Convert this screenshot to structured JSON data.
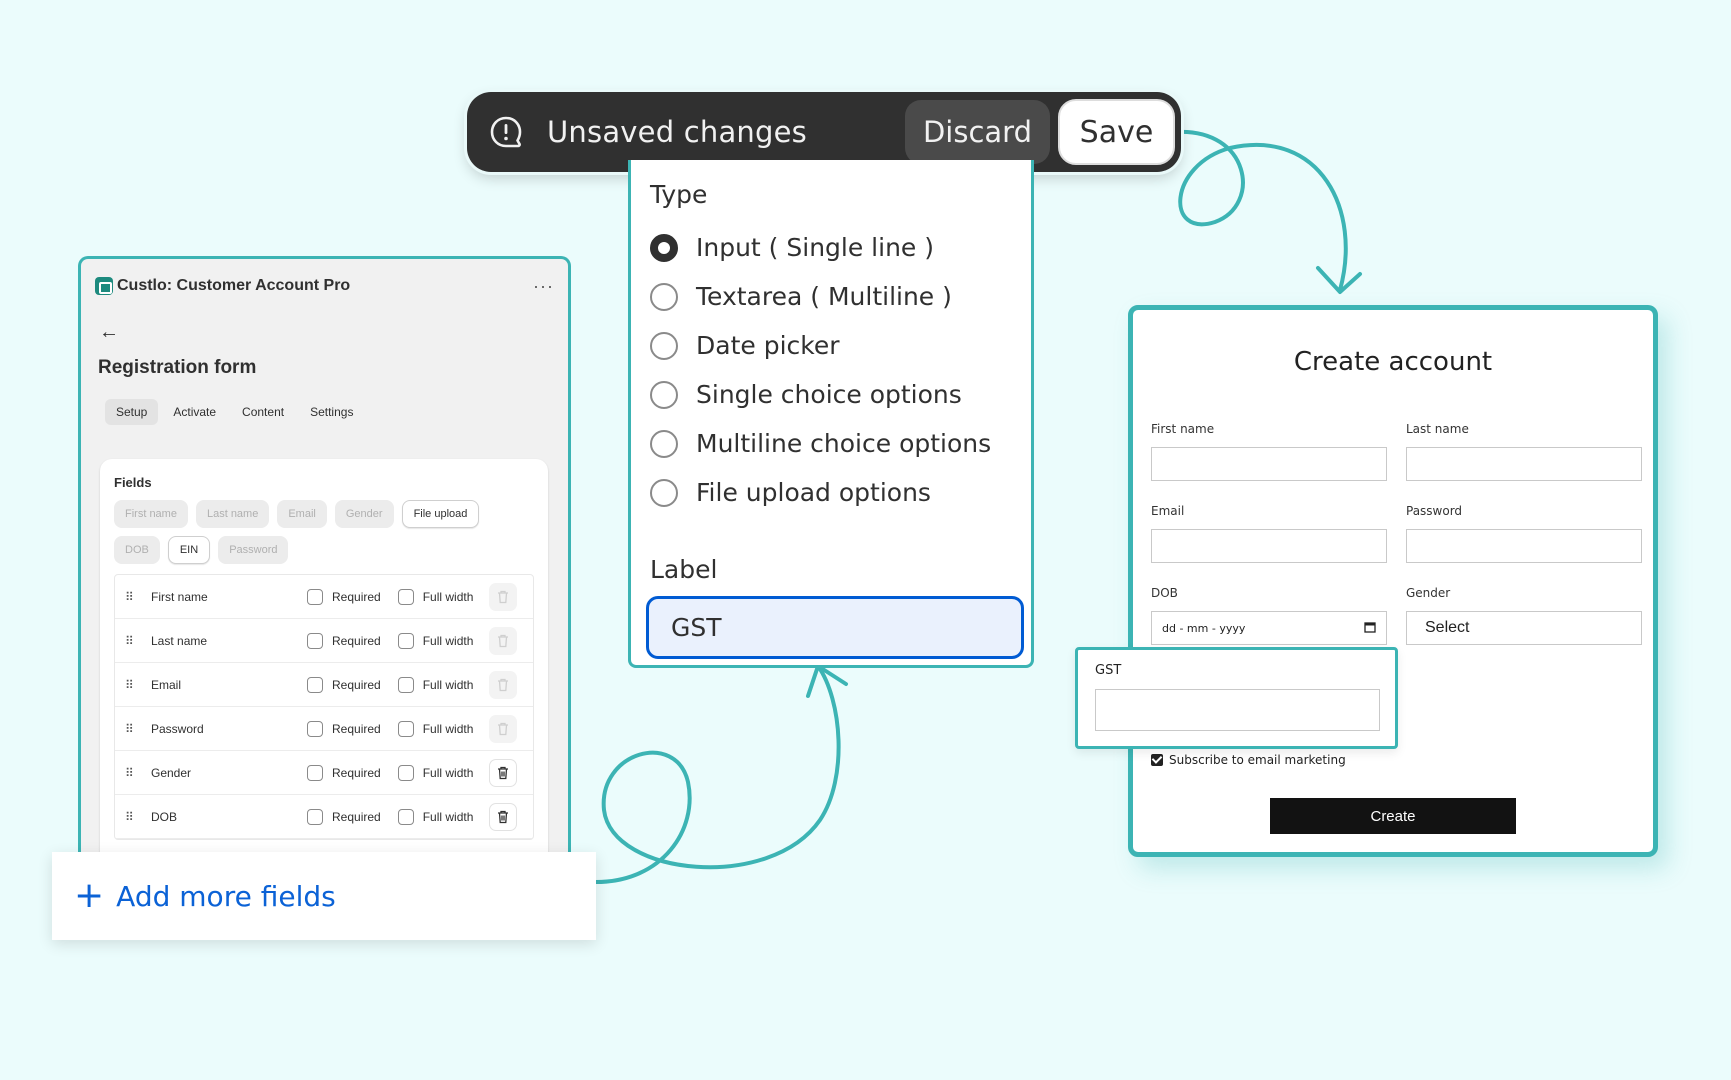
{
  "save_bar": {
    "title": "Unsaved changes",
    "discard_label": "Discard",
    "save_label": "Save"
  },
  "type_panel": {
    "type_title": "Type",
    "options": [
      {
        "label": "Input ( Single line )",
        "selected": true
      },
      {
        "label": "Textarea ( Multiline )",
        "selected": false
      },
      {
        "label": "Date picker",
        "selected": false
      },
      {
        "label": "Single choice options",
        "selected": false
      },
      {
        "label": "Multiline choice options",
        "selected": false
      },
      {
        "label": "File upload options",
        "selected": false
      }
    ],
    "label_title": "Label",
    "label_value": "GST"
  },
  "app": {
    "title": "Custlo: Customer Account Pro",
    "menu_glyph": "···",
    "back_glyph": "←",
    "form_title": "Registration form",
    "tabs": [
      "Setup",
      "Activate",
      "Content",
      "Settings"
    ],
    "fields_title": "Fields",
    "chips": [
      {
        "label": "First name",
        "selected": false
      },
      {
        "label": "Last name",
        "selected": false
      },
      {
        "label": "Email",
        "selected": false
      },
      {
        "label": "Gender",
        "selected": false
      },
      {
        "label": "File upload",
        "selected": true
      },
      {
        "label": "DOB",
        "selected": false
      },
      {
        "label": "EIN",
        "selected": true
      },
      {
        "label": "Password",
        "selected": false
      }
    ],
    "required_label": "Required",
    "full_width_label": "Full width",
    "rows": [
      {
        "name": "First name",
        "deletable": false
      },
      {
        "name": "Last name",
        "deletable": false
      },
      {
        "name": "Email",
        "deletable": false
      },
      {
        "name": "Password",
        "deletable": false
      },
      {
        "name": "Gender",
        "deletable": true
      },
      {
        "name": "DOB",
        "deletable": true
      }
    ],
    "add_more_label": "Add more fields"
  },
  "storefront": {
    "title": "Create account",
    "first_name_label": "First name",
    "last_name_label": "Last name",
    "email_label": "Email",
    "password_label": "Password",
    "dob_label": "DOB",
    "dob_placeholder": "dd - mm - yyyy",
    "gender_label": "Gender",
    "gender_value": "Select",
    "gst_label": "GST",
    "subscribe_label": "Subscribe to email marketing",
    "create_label": "Create"
  },
  "colors": {
    "accent_teal": "#3cb4b4",
    "link_blue": "#0b62d6",
    "bar_dark": "#303030",
    "background": "#ebfcfc"
  }
}
